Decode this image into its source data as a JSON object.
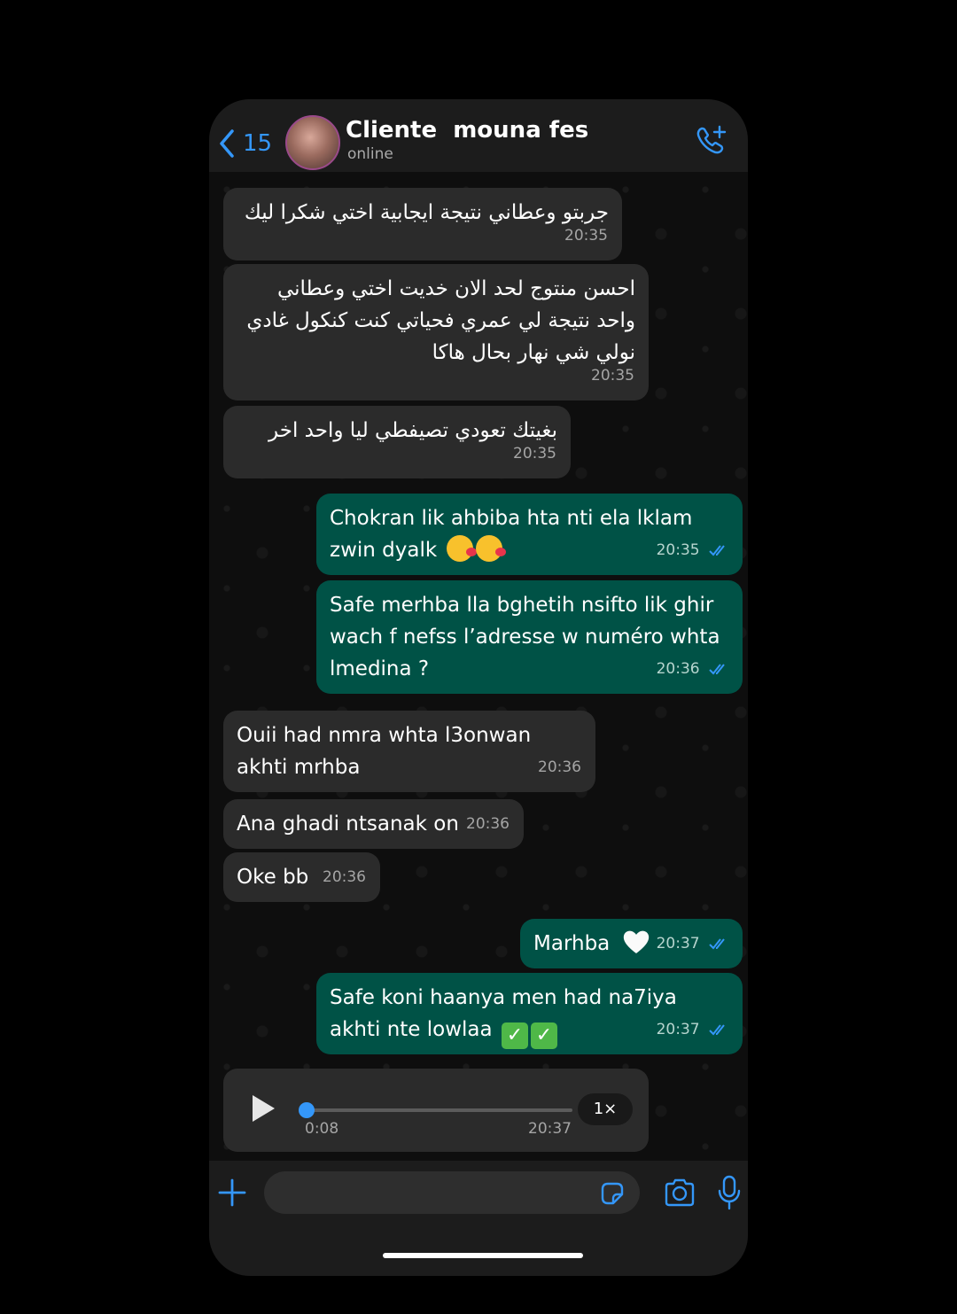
{
  "header": {
    "back_count": "15",
    "contact_name": "Cliente  mouna fes",
    "status": "online",
    "accent_color": "#3497f9",
    "call_icon": "add-call-icon"
  },
  "messages": [
    {
      "dir": "in",
      "rtl": true,
      "text": "جربتو وعطاني نتيجة ايجابية اختي شكرا ليك",
      "time": "20:35"
    },
    {
      "dir": "in",
      "rtl": true,
      "text": "احسن منتوج لحد الان خديت اختي وعطاني واحد نتيجة لي عمري فحياتي كنت كنكول غادي نولي شي نهار بحال هاكا",
      "time": "20:35"
    },
    {
      "dir": "in",
      "rtl": true,
      "text": "بغيتك تعودي تصيفطي ليا واحد اخر",
      "time": "20:35"
    },
    {
      "dir": "out",
      "text": "Chokran lik ahbiba hta nti ela lklam zwin dyalk",
      "emoji": "😘😘",
      "time": "20:35",
      "read": true
    },
    {
      "dir": "out",
      "text": "Safe merhba lla bghetih nsifto lik ghir wach f nefss l’adresse w numéro whta lmedina ?",
      "time": "20:36",
      "read": true
    },
    {
      "dir": "in",
      "text": "Ouii had nmra whta l3onwan akhti mrhba",
      "time": "20:36"
    },
    {
      "dir": "in",
      "text": "Ana ghadi ntsanak on",
      "time": "20:36"
    },
    {
      "dir": "in",
      "text": "Oke bb",
      "time": "20:36"
    },
    {
      "dir": "out",
      "text": "Marhba",
      "emoji": "🤍",
      "time": "20:37",
      "read": true
    },
    {
      "dir": "out",
      "text": "Safe koni haanya men had na7iya akhti nte lowlaa",
      "emoji": "✅✅",
      "time": "20:37",
      "read": true
    }
  ],
  "voice_note": {
    "duration": "0:08",
    "time": "20:37",
    "speed": "1×",
    "progress": 0.02
  },
  "input": {
    "placeholder": "",
    "icons": [
      "plus-icon",
      "sticker-icon",
      "camera-icon",
      "microphone-icon"
    ]
  },
  "colors": {
    "incoming_bubble": "#2b2b2b",
    "outgoing_bubble": "#005246",
    "read_ticks": "#3497f9"
  }
}
